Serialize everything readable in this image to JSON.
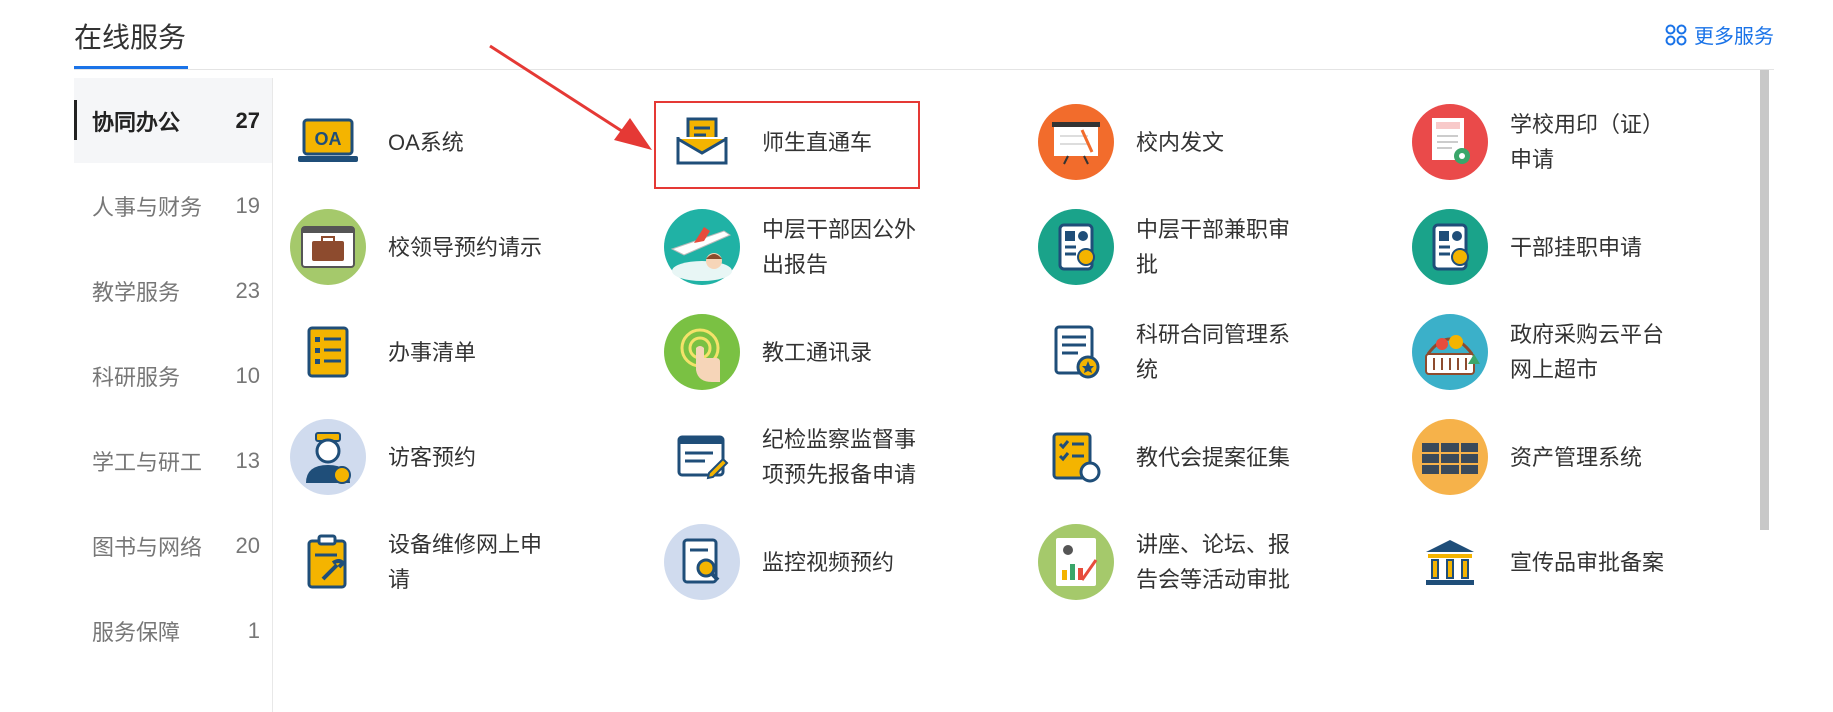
{
  "header": {
    "title": "在线服务",
    "more_label": "更多服务"
  },
  "sidebar": {
    "items": [
      {
        "label": "协同办公",
        "count": "27",
        "active": true
      },
      {
        "label": "人事与财务",
        "count": "19"
      },
      {
        "label": "教学服务",
        "count": "23"
      },
      {
        "label": "科研服务",
        "count": "10"
      },
      {
        "label": "学工与研工",
        "count": "13"
      },
      {
        "label": "图书与网络",
        "count": "20"
      },
      {
        "label": "服务保障",
        "count": "1"
      }
    ]
  },
  "services": [
    {
      "label": "OA系统",
      "icon": "oa-laptop-icon"
    },
    {
      "label": "师生直通车",
      "icon": "envelope-icon",
      "highlighted": true
    },
    {
      "label": "校内发文",
      "icon": "presentation-board-icon"
    },
    {
      "label": "学校用印（证）申请",
      "icon": "contract-seal-icon"
    },
    {
      "label": "校领导预约请示",
      "icon": "briefcase-window-icon"
    },
    {
      "label": "中层干部因公外出报告",
      "icon": "airplane-icon"
    },
    {
      "label": "中层干部兼职审批",
      "icon": "id-card-badge-icon"
    },
    {
      "label": "干部挂职申请",
      "icon": "id-card-badge-icon"
    },
    {
      "label": "办事清单",
      "icon": "checklist-icon"
    },
    {
      "label": "教工通讯录",
      "icon": "touch-finger-icon"
    },
    {
      "label": "科研合同管理系统",
      "icon": "document-star-icon"
    },
    {
      "label": "政府采购云平台网上超市",
      "icon": "shopping-basket-icon"
    },
    {
      "label": "访客预约",
      "icon": "visitor-person-icon"
    },
    {
      "label": "纪检监察监督事项预先报备申请",
      "icon": "form-pen-icon"
    },
    {
      "label": "教代会提案征集",
      "icon": "proposal-list-icon"
    },
    {
      "label": "资产管理系统",
      "icon": "server-rack-icon"
    },
    {
      "label": "设备维修网上申请",
      "icon": "clipboard-wrench-icon"
    },
    {
      "label": "监控视频预约",
      "icon": "document-search-icon"
    },
    {
      "label": "讲座、论坛、报告会等活动审批",
      "icon": "presentation-chart-icon"
    },
    {
      "label": "宣传品审批备案",
      "icon": "institution-building-icon"
    }
  ],
  "colors": {
    "accent": "#1a73e8",
    "highlight": "#e53935",
    "arrow": "#e53935"
  }
}
